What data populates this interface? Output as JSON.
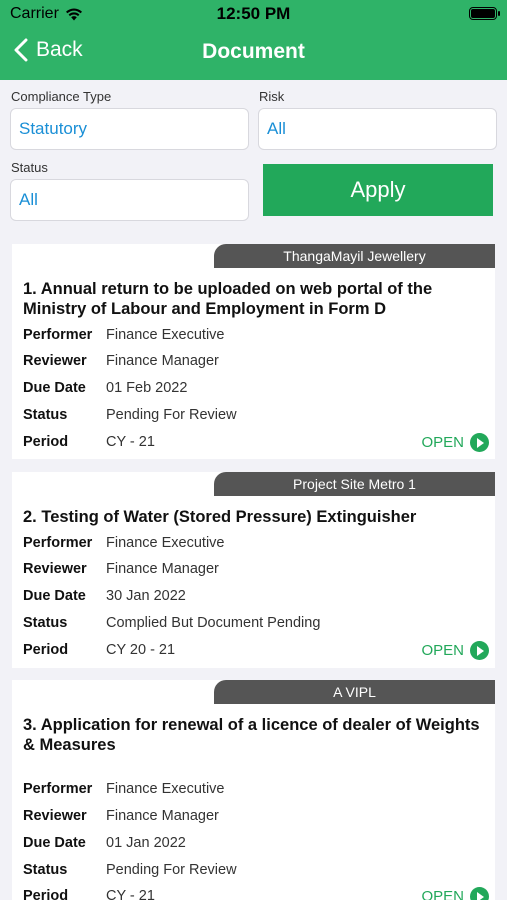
{
  "status_bar": {
    "carrier": "Carrier",
    "time": "12:50 PM"
  },
  "nav": {
    "back_label": "Back",
    "title": "Document"
  },
  "filters": {
    "compliance_type": {
      "label": "Compliance Type",
      "value": "Statutory"
    },
    "risk": {
      "label": "Risk",
      "value": "All"
    },
    "status": {
      "label": "Status",
      "value": "All"
    },
    "apply_label": "Apply"
  },
  "field_labels": {
    "performer": "Performer",
    "reviewer": "Reviewer",
    "due_date": "Due Date",
    "status": "Status",
    "period": "Period"
  },
  "open_label": "OPEN",
  "cards": [
    {
      "tag": "ThangaMayil Jewellery",
      "title": "1. Annual return to be uploaded on web portal of the Ministry of Labour and Employment in Form D",
      "performer": "Finance Executive",
      "reviewer": "Finance Manager",
      "due_date": "01 Feb 2022",
      "status": "Pending For Review",
      "period": "CY - 21"
    },
    {
      "tag": "Project Site Metro 1",
      "title": "2. Testing of Water (Stored Pressure) Extinguisher",
      "performer": "Finance Executive",
      "reviewer": "Finance Manager",
      "due_date": "30 Jan 2022",
      "status": "Complied But Document Pending",
      "period": "CY 20 - 21"
    },
    {
      "tag": "A VIPL",
      "title": "3. Application for renewal of a licence of dealer of Weights & Measures",
      "performer": "Finance Executive",
      "reviewer": "Finance Manager",
      "due_date": "01 Jan 2022",
      "status": "Pending For Review",
      "period": "CY - 21"
    }
  ],
  "colors": {
    "brand_green": "#2fb368",
    "button_green": "#22a85a",
    "input_text": "#1a8fd6",
    "tag_bg": "#555555"
  }
}
